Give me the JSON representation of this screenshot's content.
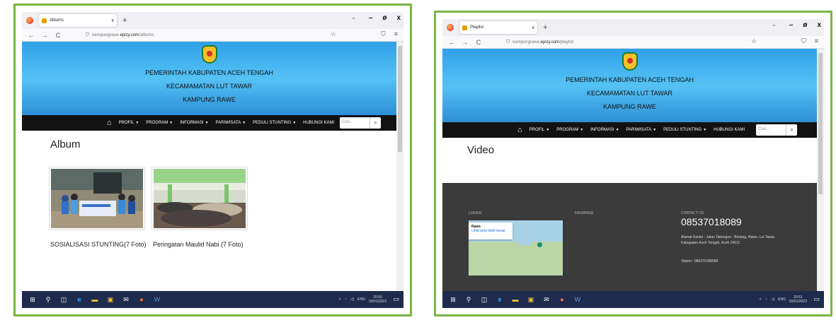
{
  "left": {
    "tab_title": "Albums",
    "url_plain": "kampungrawe.",
    "url_domain": "epizy.com",
    "url_path": "/albums",
    "hero": [
      "PEMERINTAH KABUPATEN ACEH TENGAH",
      "KECAMAMATAN LUT TAWAR",
      "KAMPUNG RAWE"
    ],
    "menu": [
      "PROFIL",
      "PROGRAM",
      "INFORMASI",
      "PARIWISATA",
      "PEDULI STUNTING",
      "HUBUNGI KAMI"
    ],
    "search_placeholder": "Cari...",
    "heading": "Album",
    "albums": [
      {
        "caption": "SOSIALISASI STUNTING(7 Foto)"
      },
      {
        "caption": "Peringatan Maulid Nabi (7 Foto)"
      }
    ],
    "clock_time": "20:50",
    "clock_date": "03/01/2023",
    "tray_lang": "ENG"
  },
  "right": {
    "tab_title": "Playlist",
    "url_plain": "kampungrawe.",
    "url_domain": "epizy.com",
    "url_path": "/playlist",
    "hero": [
      "PEMERINTAH KABUPATEN ACEH TENGAH",
      "KECAMAMATAN LUT TAWAR",
      "KAMPUNG RAWE"
    ],
    "menu": [
      "PROFIL",
      "PROGRAM",
      "INFORMASI",
      "PARIWISATA",
      "PEDULI STUNTING",
      "HUBUNGI KAMI"
    ],
    "search_placeholder": "Cari...",
    "heading": "Video",
    "footer": {
      "lokasi_label": "LOKASI",
      "fanspage_label": "FANSPAGE",
      "contact_label": "CONTACT US",
      "phone": "08537018089",
      "address": "Alamat Kantor : Jalan Takengon - Bintang, Rawe, Lut Tawar, Kabupaten Aceh Tengah, Aceh 24511",
      "telpon": "Telpon : 085370188089",
      "map_place": "Rawe",
      "map_link": "Lihat peta lebih besar"
    },
    "clock_time": "20:51",
    "clock_date": "03/01/2023",
    "tray_lang": "ENG"
  },
  "icons": {
    "back": "←",
    "forward": "→",
    "reload": "C",
    "home": "🏠",
    "search": "🔍",
    "star": "☆",
    "shield": "⛉",
    "menu": "≡",
    "windows": "⊞",
    "minimize": "–",
    "maximize": "ø",
    "close": "x"
  }
}
